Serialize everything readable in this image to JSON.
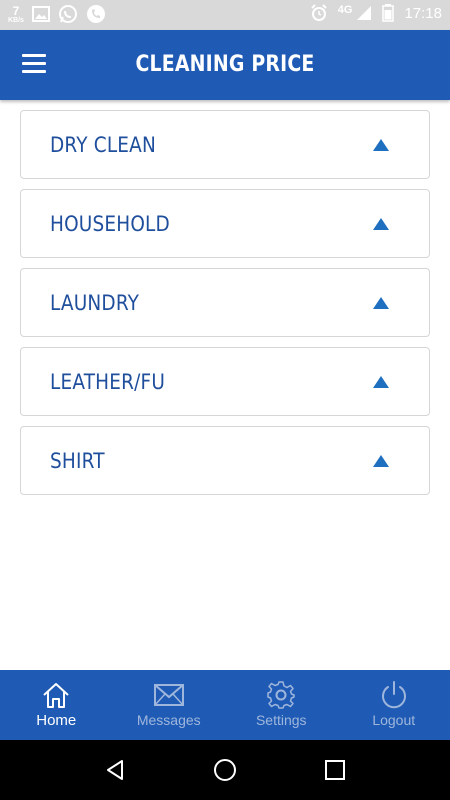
{
  "status_bar": {
    "speed_value": "7",
    "speed_unit": "KB/s",
    "network": "4G",
    "time": "17:18"
  },
  "app_bar": {
    "title": "CLEANING PRICE",
    "menu_icon": "hamburger-menu-icon"
  },
  "categories": [
    {
      "label": "DRY CLEAN",
      "icon": "chevron-up-icon"
    },
    {
      "label": "HOUSEHOLD",
      "icon": "chevron-up-icon"
    },
    {
      "label": "LAUNDRY",
      "icon": "chevron-up-icon"
    },
    {
      "label": "LEATHER/FU",
      "icon": "chevron-up-icon"
    },
    {
      "label": "SHIRT",
      "icon": "chevron-up-icon"
    }
  ],
  "bottom_nav": {
    "items": [
      {
        "label": "Home",
        "icon": "home-icon",
        "active": true
      },
      {
        "label": "Messages",
        "icon": "mail-icon",
        "active": false
      },
      {
        "label": "Settings",
        "icon": "gear-icon",
        "active": false
      },
      {
        "label": "Logout",
        "icon": "power-icon",
        "active": false
      }
    ]
  },
  "colors": {
    "primary": "#1f5bb5",
    "label_text": "#1f4e9c",
    "arrow": "#1f6fc0",
    "inactive_nav_text": "#9fb6dc"
  }
}
